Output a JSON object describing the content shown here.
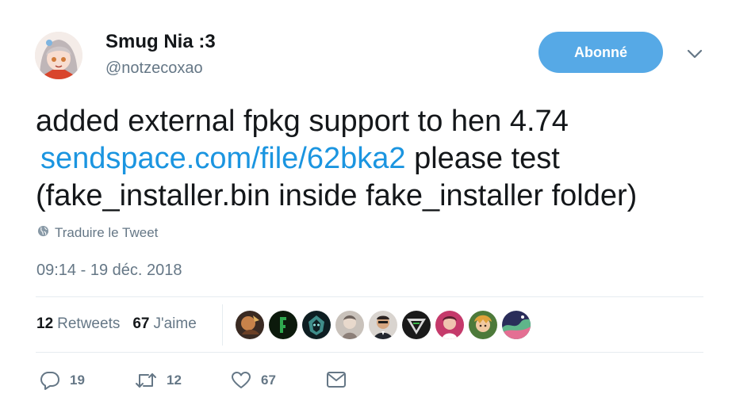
{
  "user": {
    "display_name": "Smug Nia :3",
    "handle": "@notzecoxao",
    "follow_label": "Abonné"
  },
  "tweet": {
    "line1": "added external fpkg support to hen 4.74",
    "link": "sendspace.com/file/62bka2",
    "line2_rest": " please test",
    "line3": "(fake_installer.bin inside fake_installer folder)",
    "translate_label": "Traduire le Tweet",
    "timestamp": "09:14 - 19 déc. 2018"
  },
  "stats": {
    "retweets_count": "12",
    "retweets_label": "Retweets",
    "likes_count": "67",
    "likes_label": "J'aime"
  },
  "likers": [
    {
      "icon": "avatar-icon"
    },
    {
      "icon": "avatar-icon"
    },
    {
      "icon": "avatar-icon"
    },
    {
      "icon": "avatar-icon"
    },
    {
      "icon": "avatar-icon"
    },
    {
      "icon": "avatar-icon"
    },
    {
      "icon": "avatar-icon"
    },
    {
      "icon": "avatar-icon"
    },
    {
      "icon": "avatar-icon"
    }
  ],
  "actions": {
    "reply_count": "19",
    "retweet_count": "12",
    "like_count": "67"
  },
  "colors": {
    "accent": "#1b95e0",
    "follow_button": "#56a9e6",
    "secondary_text": "#657786",
    "divider": "#e6ecf0"
  }
}
